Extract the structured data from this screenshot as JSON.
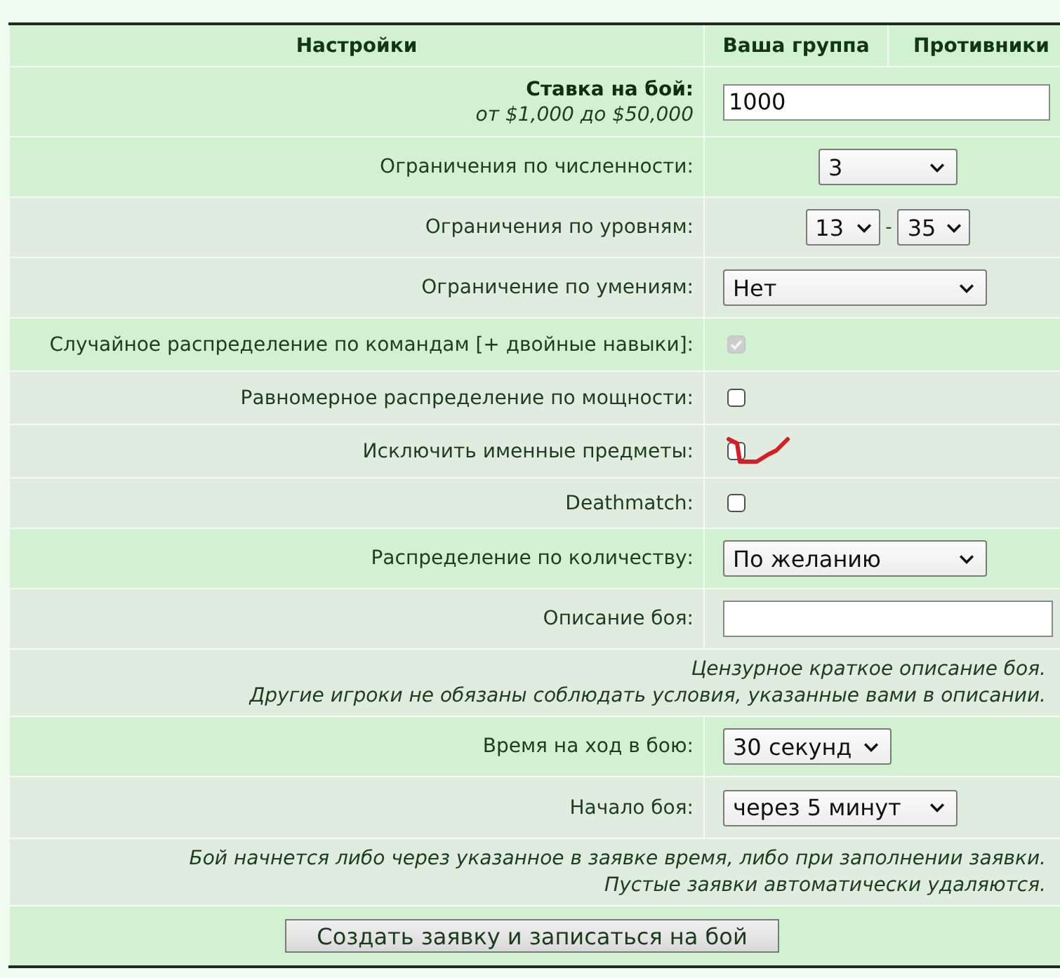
{
  "columns": [
    {
      "label": "Настройки"
    },
    {
      "label": "Ваша группа"
    },
    {
      "label": "Противники"
    }
  ],
  "rows": [
    {
      "kind": "text_input",
      "label": "Ставка на бой:",
      "sublabel": "от $1,000 до $50,000",
      "value": "1000",
      "highlighted": true
    },
    {
      "kind": "select",
      "label": "Ограничения по численности:",
      "value": "3",
      "highlighted": true
    },
    {
      "kind": "range",
      "label": "Ограничения по уровням:",
      "from": "13",
      "separator": "-",
      "to": "35",
      "highlighted": false
    },
    {
      "kind": "select",
      "label": "Ограничение по умениям:",
      "value": "Нет",
      "highlighted": false
    },
    {
      "kind": "checkbox",
      "label": "Случайное распределение по командам [+ двойные навыки]:",
      "checked": true,
      "disabled": true,
      "highlighted": true
    },
    {
      "kind": "checkbox",
      "label": "Равномерное распределение по мощности:",
      "checked": false,
      "disabled": false,
      "highlighted": false
    },
    {
      "kind": "checkbox",
      "label": "Исключить именные предметы:",
      "checked": false,
      "disabled": false,
      "annotated": true,
      "highlighted": false
    },
    {
      "kind": "checkbox",
      "label": "Deathmatch:",
      "checked": false,
      "disabled": false,
      "highlighted": false
    },
    {
      "kind": "select",
      "label": "Распределение по количеству:",
      "value": "По желанию",
      "highlighted": true
    },
    {
      "kind": "text_input",
      "label": "Описание боя:",
      "highlighted": false
    },
    {
      "kind": "hint",
      "lines": [
        "Цензурное краткое описание боя.",
        "Другие игроки не обязаны соблюдать условия, указанные вами в описании."
      ],
      "highlighted": false
    },
    {
      "kind": "select",
      "label": "Время на ход в бою:",
      "value": "30 секунд",
      "highlighted": true
    },
    {
      "kind": "select",
      "label": "Начало боя:",
      "value": "через 5 минут",
      "highlighted": false
    },
    {
      "kind": "hint",
      "lines": [
        "Бой начнется либо через указанное в заявке время, либо при заполнении заявки.",
        "Пустые заявки автоматически удаляются."
      ],
      "highlighted": false
    },
    {
      "kind": "button",
      "label": "Создать заявку и записаться на бой",
      "highlighted": true
    }
  ]
}
